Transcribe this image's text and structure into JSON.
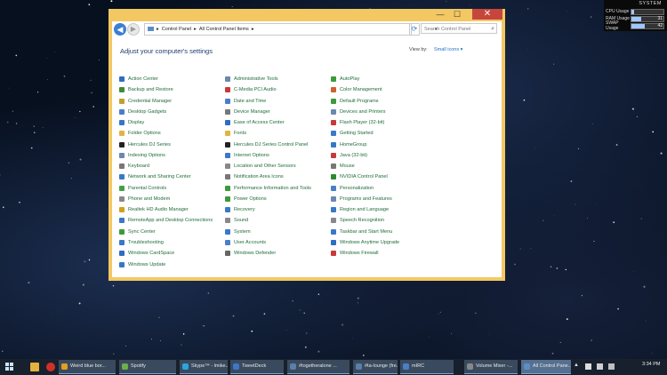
{
  "system_meter": {
    "title": "SYSTEM",
    "rows": [
      {
        "label": "CPU Usage",
        "value": "",
        "fill": 0.08
      },
      {
        "label": "RAM Usage",
        "value": "31",
        "fill": 0.31
      },
      {
        "label": "SWAP Usage",
        "value": "42",
        "fill": 0.42
      }
    ]
  },
  "window": {
    "breadcrumb": [
      "Control Panel",
      "▸",
      "All Control Panel Items",
      "▸"
    ],
    "search_placeholder": "Search Control Panel",
    "heading": "Adjust your computer's settings",
    "view_by_label": "View by:",
    "view_by_value": "Small icons ▾",
    "columns": [
      [
        {
          "label": "Action Center",
          "color": "#2f6cc4"
        },
        {
          "label": "Backup and Restore",
          "color": "#3e8b3a"
        },
        {
          "label": "Credential Manager",
          "color": "#c0a030"
        },
        {
          "label": "Desktop Gadgets",
          "color": "#4a7fc8"
        },
        {
          "label": "Display",
          "color": "#3477c8"
        },
        {
          "label": "Folder Options",
          "color": "#e0b440"
        },
        {
          "label": "Hercules DJ Series",
          "color": "#222222"
        },
        {
          "label": "Indexing Options",
          "color": "#6a88b0"
        },
        {
          "label": "Keyboard",
          "color": "#777777"
        },
        {
          "label": "Network and Sharing Center",
          "color": "#3a78c8"
        },
        {
          "label": "Parental Controls",
          "color": "#45a045"
        },
        {
          "label": "Phone and Modem",
          "color": "#888888"
        },
        {
          "label": "Realtek HD Audio Manager",
          "color": "#d0a020"
        },
        {
          "label": "RemoteApp and Desktop Connections",
          "color": "#3a78c8"
        },
        {
          "label": "Sync Center",
          "color": "#3c9a3c"
        },
        {
          "label": "Troubleshooting",
          "color": "#3a78c8"
        },
        {
          "label": "Windows CardSpace",
          "color": "#2f6cc4"
        },
        {
          "label": "Windows Update",
          "color": "#3477c8"
        }
      ],
      [
        {
          "label": "Administrative Tools",
          "color": "#6a88b0"
        },
        {
          "label": "C-Media PCI Audio",
          "color": "#c83a3a"
        },
        {
          "label": "Date and Time",
          "color": "#4a7fc8"
        },
        {
          "label": "Device Manager",
          "color": "#777777"
        },
        {
          "label": "Ease of Access Center",
          "color": "#2f6cc4"
        },
        {
          "label": "Fonts",
          "color": "#e0b440"
        },
        {
          "label": "Hercules DJ Series Control Panel",
          "color": "#222222"
        },
        {
          "label": "Internet Options",
          "color": "#3a78c8"
        },
        {
          "label": "Location and Other Sensors",
          "color": "#888888"
        },
        {
          "label": "Notification Area Icons",
          "color": "#777777"
        },
        {
          "label": "Performance Information and Tools",
          "color": "#3c9a3c"
        },
        {
          "label": "Power Options",
          "color": "#3c9a3c"
        },
        {
          "label": "Recovery",
          "color": "#3a78c8"
        },
        {
          "label": "Sound",
          "color": "#888888"
        },
        {
          "label": "System",
          "color": "#3a78c8"
        },
        {
          "label": "User Accounts",
          "color": "#4a7fc8"
        },
        {
          "label": "Windows Defender",
          "color": "#666666"
        }
      ],
      [
        {
          "label": "AutoPlay",
          "color": "#3c9a3c"
        },
        {
          "label": "Color Management",
          "color": "#d06030"
        },
        {
          "label": "Default Programs",
          "color": "#3c9a3c"
        },
        {
          "label": "Devices and Printers",
          "color": "#6a88b0"
        },
        {
          "label": "Flash Player (32-bit)",
          "color": "#c83a3a"
        },
        {
          "label": "Getting Started",
          "color": "#3a78c8"
        },
        {
          "label": "HomeGroup",
          "color": "#3477c8"
        },
        {
          "label": "Java (32-bit)",
          "color": "#c83a3a"
        },
        {
          "label": "Mouse",
          "color": "#777777"
        },
        {
          "label": "NVIDIA Control Panel",
          "color": "#2d8a2d"
        },
        {
          "label": "Personalization",
          "color": "#4a7fc8"
        },
        {
          "label": "Programs and Features",
          "color": "#6a88b0"
        },
        {
          "label": "Region and Language",
          "color": "#3a78c8"
        },
        {
          "label": "Speech Recognition",
          "color": "#888888"
        },
        {
          "label": "Taskbar and Start Menu",
          "color": "#3a78c8"
        },
        {
          "label": "Windows Anytime Upgrade",
          "color": "#2f6cc4"
        },
        {
          "label": "Windows Firewall",
          "color": "#c83a3a"
        }
      ]
    ]
  },
  "taskbar": {
    "apps": [
      {
        "label": "Weird blue bor...",
        "color": "#e0a020"
      },
      {
        "label": "Spotify",
        "color": "#6ab04c"
      },
      {
        "label": "Skype™ - lmike...",
        "color": "#2aa5e0"
      },
      {
        "label": "TweetDeck",
        "color": "#3a78c8"
      },
      {
        "label": "#togetheralone ...",
        "color": "#5a7fa8"
      },
      {
        "label": "#ta-lounge (fre...",
        "color": "#5a7fa8"
      },
      {
        "label": "mIRC",
        "color": "#4a7fc8"
      },
      {
        "label": "Volume Mixer -...",
        "color": "#888888"
      },
      {
        "label": "All Control Pane...",
        "color": "#5b8ec9"
      }
    ],
    "time": "3:34 PM",
    "tray_arrow": "▲"
  }
}
